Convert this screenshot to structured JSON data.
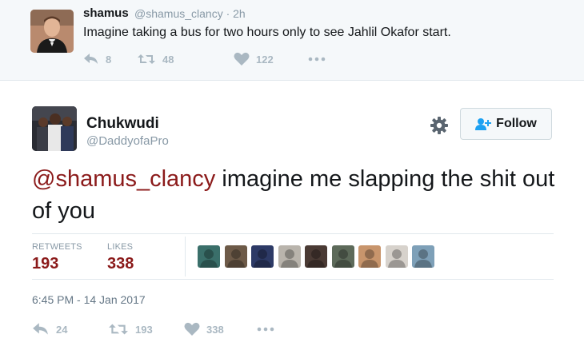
{
  "parent_tweet": {
    "name": "shamus",
    "handle": "@shamus_clancy · 2h",
    "text": "Imagine taking a bus for two hours only to see Jahlil Okafor start.",
    "replies": "8",
    "retweets": "48",
    "likes": "122"
  },
  "main_tweet": {
    "name": "Chukwudi",
    "handle": "@DaddyofaPro",
    "follow_label": "Follow",
    "mention": "@shamus_clancy",
    "text_rest": " imagine me slapping the shit out of you",
    "retweets_label": "RETWEETS",
    "retweets_value": "193",
    "likes_label": "LIKES",
    "likes_value": "338",
    "timestamp": "6:45 PM - 14 Jan 2017",
    "action_replies": "24",
    "action_retweets": "193",
    "action_likes": "338"
  },
  "likers": [
    {
      "color": "#3a6f6a"
    },
    {
      "color": "#6d5a48"
    },
    {
      "color": "#2d3a66"
    },
    {
      "color": "#b9b4ac"
    },
    {
      "color": "#4a3a34"
    },
    {
      "color": "#5d6a5a"
    },
    {
      "color": "#c8956c"
    },
    {
      "color": "#d7d2cc"
    },
    {
      "color": "#7ea0b8"
    }
  ],
  "colors": {
    "mention": "#8b1a1a",
    "stat_value": "#8b1a1a",
    "icon_gray": "#aab8c2"
  }
}
